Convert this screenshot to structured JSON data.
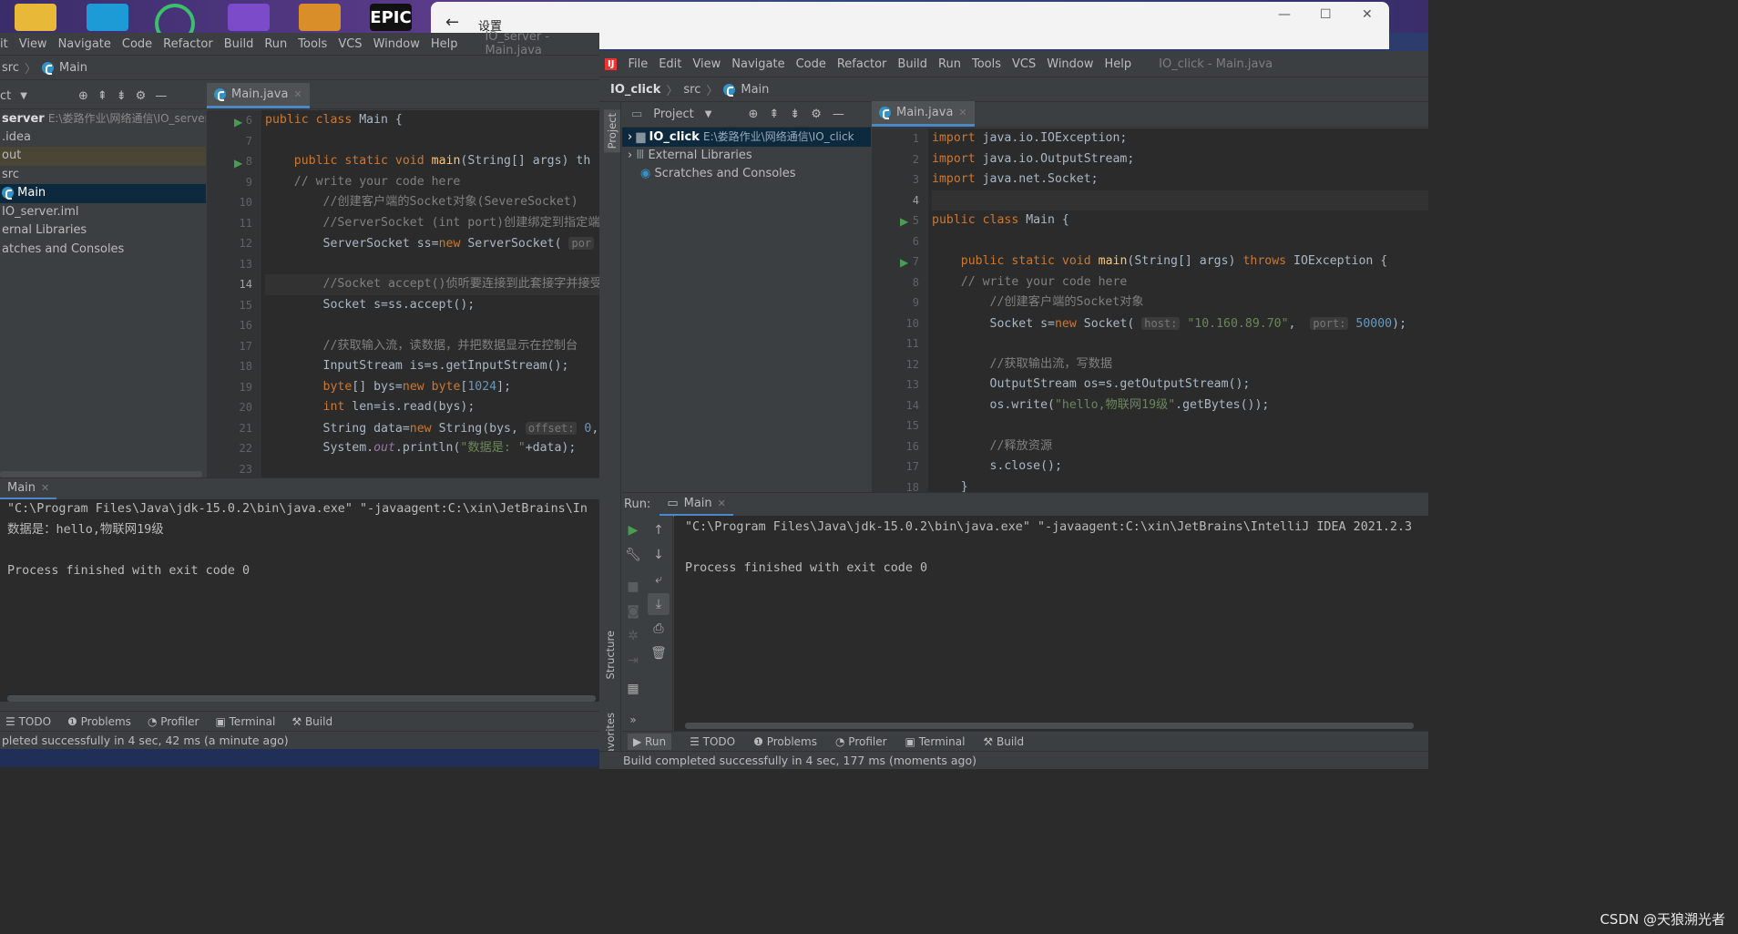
{
  "desktop": {
    "watermark": "CSDN @天狼溯光者",
    "epic_label": "EPIC"
  },
  "settings_window": {
    "title": "设置",
    "back": "←",
    "minimize": "—",
    "maximize": "☐",
    "close": "✕"
  },
  "ide_left": {
    "menu": [
      "it",
      "View",
      "Navigate",
      "Code",
      "Refactor",
      "Build",
      "Run",
      "Tools",
      "VCS",
      "Window",
      "Help"
    ],
    "window_title": "IO_server - Main.java",
    "breadcrumb": [
      "src",
      "Main"
    ],
    "project_label": "ct",
    "tree": [
      {
        "label": "server",
        "path": "E:\\娄路作业\\网络通信\\IO_server"
      },
      {
        "label": ".idea"
      },
      {
        "label": "out"
      },
      {
        "label": "src"
      },
      {
        "label": "Main"
      },
      {
        "label": "IO_server.iml"
      },
      {
        "label": "ernal Libraries"
      },
      {
        "label": "atches and Consoles"
      }
    ],
    "tab": "Main.java",
    "line_numbers": [
      "6",
      "7",
      "8",
      "9",
      "10",
      "11",
      "12",
      "13",
      "14",
      "15",
      "16",
      "17",
      "18",
      "19",
      "20",
      "21",
      "22",
      "23"
    ],
    "code": {
      "l6": "public class Main {",
      "l8_a": "    public static void ",
      "l8_fn": "main",
      "l8_b": "(String[] args) th",
      "l9": "    // write your code here",
      "l10": "        //创建客户端的Socket对象(SevereSocket)",
      "l11": "        //ServerSocket (int port)创建绑定到指定端",
      "l12_a": "        ServerSocket ss=",
      "l12_kw": "new",
      "l12_b": " ServerSocket( ",
      "l12_hint": "por",
      "l14": "        //Socket accept()侦听要连接到此套接字并接受",
      "l15": "        Socket s=ss.accept();",
      "l17": "        //获取输入流，读数据，并把数据显示在控制台",
      "l18": "        InputStream is=s.getInputStream();",
      "l19_kw": "byte",
      "l19_a": "[] bys=",
      "l19_num": "1024",
      "l20_kw": "int",
      "l20_a": " len=is.read(bys);",
      "l21_a": "        String data=",
      "l21_b": " String(bys, ",
      "l21_hint": "offset:",
      "l21_num": "0",
      "l21_c": ",l",
      "l22_a": "        System.",
      "l22_out": "out",
      "l22_b": ".println(",
      "l22_str": "\"数据是: \"",
      "l22_c": "+data);"
    },
    "run_tab": "Main",
    "console": [
      "\"C:\\Program Files\\Java\\jdk-15.0.2\\bin\\java.exe\" \"-javaagent:C:\\xin\\JetBrains\\In",
      "数据是：hello,物联网19级",
      "",
      "Process finished with exit code 0"
    ],
    "bottom_tabs": [
      "TODO",
      "Problems",
      "Profiler",
      "Terminal",
      "Build"
    ],
    "status": "pleted successfully in 4 sec, 42 ms (a minute ago)"
  },
  "ide_right": {
    "menu": [
      "File",
      "Edit",
      "View",
      "Navigate",
      "Code",
      "Refactor",
      "Build",
      "Run",
      "Tools",
      "VCS",
      "Window",
      "Help"
    ],
    "window_title": "IO_click - Main.java",
    "breadcrumb": [
      "IO_click",
      "src",
      "Main"
    ],
    "project_label": "Project",
    "tree": [
      {
        "label": "IO_click",
        "path": "E:\\娄路作业\\网络通信\\IO_click"
      },
      {
        "label": "External Libraries"
      },
      {
        "label": "Scratches and Consoles"
      }
    ],
    "side_labels": {
      "project": "Project",
      "structure": "Structure",
      "favorites": "Favorites"
    },
    "tab": "Main.java",
    "line_numbers": [
      "1",
      "2",
      "3",
      "4",
      "5",
      "6",
      "7",
      "8",
      "9",
      "10",
      "11",
      "12",
      "13",
      "14",
      "15",
      "16",
      "17",
      "18"
    ],
    "code": {
      "l1": " java.io.IOException;",
      "l2": " java.io.OutputStream;",
      "l3": " java.net.Socket;",
      "import_kw": "import",
      "l5": "public class Main {",
      "l7_a": "    public static void ",
      "l7_fn": "main",
      "l7_b": "(String[] args) ",
      "l7_kw": "throws",
      "l7_c": " IOException {",
      "l8": "    // write your code here",
      "l9": "        //创建客户端的Socket对象",
      "l10_a": "        Socket s=",
      "l10_kw": "new",
      "l10_b": " Socket( ",
      "l10_host": "host:",
      "l10_str": "\"10.160.89.70\"",
      "l10_port": "port:",
      "l10_num": "50000",
      "l10_c": ");",
      "l12": "        //获取输出流，写数据",
      "l13": "        OutputStream os=s.getOutputStream();",
      "l14_a": "        os.write(",
      "l14_str": "\"hello,物联网19级\"",
      "l14_b": ".getBytes());",
      "l16": "        //释放资源",
      "l17": "        s.close();",
      "l18": "    }"
    },
    "run_label": "Run:",
    "run_tab": "Main",
    "console": [
      "\"C:\\Program Files\\Java\\jdk-15.0.2\\bin\\java.exe\" \"-javaagent:C:\\xin\\JetBrains\\IntelliJ IDEA 2021.2.3",
      "",
      "Process finished with exit code 0"
    ],
    "bottom_tabs": [
      "Run",
      "TODO",
      "Problems",
      "Profiler",
      "Terminal",
      "Build"
    ],
    "status": "Build completed successfully in 4 sec, 177 ms (moments ago)"
  }
}
